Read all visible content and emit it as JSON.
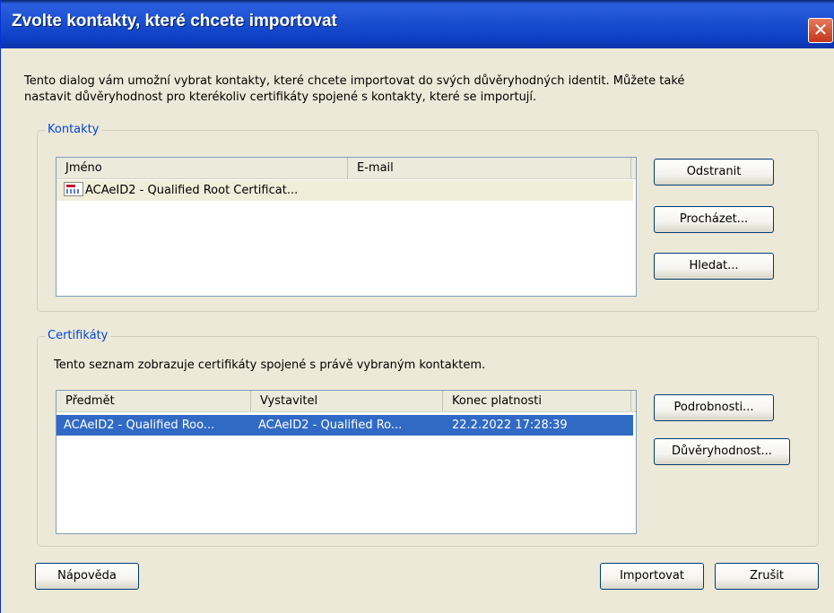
{
  "window": {
    "title": "Zvolte kontakty, které chcete importovat",
    "close_glyph": "✕"
  },
  "intro": {
    "line1": "Tento dialog vám umožní vybrat kontakty, které chcete importovat do svých důvěryhodných identit. Můžete také",
    "line2": "nastavit důvěryhodnost pro kterékoliv certifikáty spojené s kontakty, které se importují."
  },
  "contacts": {
    "group_label": "Kontakty",
    "columns": [
      "Jméno",
      "E-mail"
    ],
    "rows": [
      {
        "icon": "certificate-icon",
        "name": "ACAeID2 - Qualified Root Certificat...",
        "email": ""
      }
    ],
    "buttons": {
      "remove": "Odstranit",
      "browse": "Procházet...",
      "search": "Hledat..."
    }
  },
  "certificates": {
    "group_label": "Certifikáty",
    "description": "Tento seznam zobrazuje certifikáty spojené s právě vybraným kontaktem.",
    "columns": [
      "Předmět",
      "Vystavitel",
      "Konec platnosti"
    ],
    "rows": [
      {
        "subject": "ACAeID2 - Qualified Roo...",
        "issuer": "ACAeID2 - Qualified Ro...",
        "expires": "22.2.2022 17:28:39",
        "selected": true
      }
    ],
    "buttons": {
      "details": "Podrobnosti...",
      "trust": "Důvěryhodnost..."
    }
  },
  "footer": {
    "help": "Nápověda",
    "import": "Importovat",
    "cancel": "Zrušit"
  },
  "colors": {
    "title_bar": "#0d3fc4",
    "selection": "#316ac5",
    "group_label": "#0046d5",
    "dialog_bg": "#ece9d8"
  }
}
